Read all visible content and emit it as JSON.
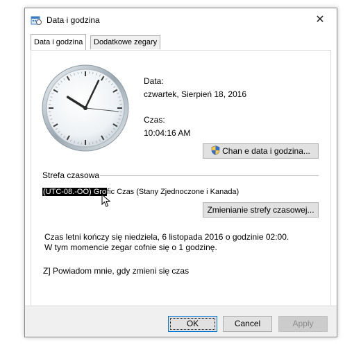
{
  "window": {
    "title": "Data i godzina",
    "close_glyph": "✕"
  },
  "tabs": [
    {
      "label": "Data i godzina",
      "active": true
    },
    {
      "label": "Dodatkowe zegary",
      "active": false
    }
  ],
  "datetime": {
    "date_label": "Data:",
    "date_value": "czwartek, Sierpień 18, 2016",
    "time_label": "Czas:",
    "time_value": "10:04:16 AM",
    "change_button": "Chan e data i godzina..."
  },
  "timezone": {
    "group_label": "Strefa czasowa",
    "selected_text": "(UTC-08.-OO) Gro",
    "rest_text": "fic Czas (Stany Zjednoczone i Kanada)",
    "change_button": "Zmienianie strefy czasowej..."
  },
  "dst": {
    "line1": "Czas letni kończy się niedziela, 6 listopada 2016 o godzinie 02:00.",
    "line2": "W tym momencie zegar cofnie się o 1 godzinę."
  },
  "notify": {
    "text": "Z] Powiadom mnie, gdy zmieni się czas"
  },
  "buttons": {
    "ok": "OK",
    "cancel": "Cancel",
    "apply": "Apply"
  },
  "colors": {
    "accent": "#0078d7",
    "selection_bg": "#000000"
  },
  "clock": {
    "hour": 10,
    "minute": 4,
    "second": 16
  }
}
